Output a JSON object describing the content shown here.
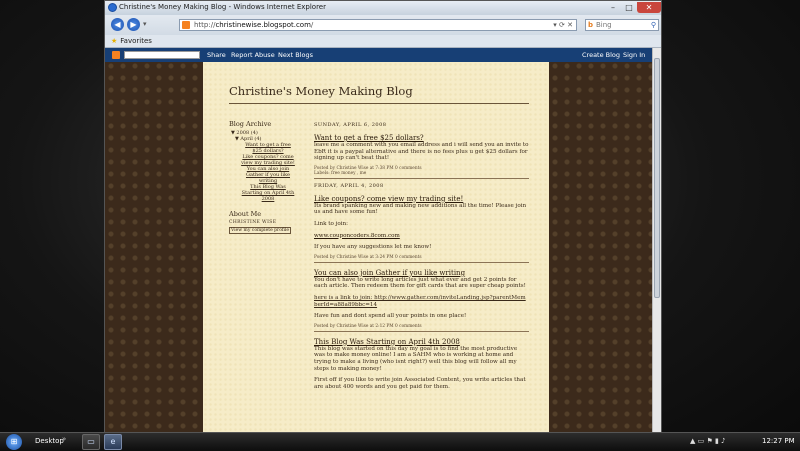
{
  "window": {
    "title": "Christine's Money Making Blog - Windows Internet Explorer",
    "minimize": "–",
    "maximize": "□",
    "close": "✕"
  },
  "nav": {
    "back_icon": "back-arrow-icon",
    "forward_icon": "forward-arrow-icon",
    "address_prefix": "http://",
    "address_host": "christinewise.blogspot.com",
    "address_suffix": "/",
    "search_engine": "Bing",
    "search_placeholder": ""
  },
  "favorites": {
    "label": "Favorites"
  },
  "blogger_bar": {
    "share": "Share",
    "report": "Report Abuse",
    "next": "Next Blogs",
    "create": "Create Blog",
    "signin": "Sign In"
  },
  "blog": {
    "title": "Christine's Money Making Blog"
  },
  "sidebar": {
    "archive_heading": "Blog Archive",
    "year": "▼ 2008 (4)",
    "month": "▼ April (4)",
    "links": [
      "Want to get a free $25 dollars?",
      "Like coupons? come view my trading site!",
      "You can also join Gather if you like writing",
      "This Blog Was Starting on April 4th 2008"
    ],
    "about_heading": "About Me",
    "author": "CHRISTINE WISE",
    "profile_link": "View my complete profile"
  },
  "posts": [
    {
      "date": "SUNDAY, APRIL 6, 2008",
      "title": "Want to get a free $25 dollars?",
      "body": [
        "leave me a comment with you email address and i will send you an invite to EbR it is a paypal alternative and there is no fees plus u get $25 dollars for signing up can't beat that!"
      ],
      "footer": "Posted by Christine Wise at 7:38 PM   0 comments",
      "labels": "Labels: free money , me"
    },
    {
      "date": "FRIDAY, APRIL 4, 2008",
      "title": "Like coupons? come view my trading site!",
      "body": [
        "Its brand spanking new and making new additions all the time! Please join us and have some fun!",
        "Link to join:",
        "www.couponcoders.8com.com",
        "If you have any suggestions let me know!"
      ],
      "footer": "Posted by Christine Wise at 3:24 PM   0 comments"
    },
    {
      "date": "",
      "title": "You can also join Gather if you like writing",
      "body": [
        "You don't have to write long articles just what ever and get 2 points for each article. Then redeem them for gift cards that are super cheap points!",
        "here is a link to join: http://www.gather.com/inviteLanding.jsp?parentMemberId=a88a89bbc=14",
        "Have fun and dont spend all your points in one place!"
      ],
      "footer": "Posted by Christine Wise at 2:12 PM   0 comments"
    },
    {
      "date": "",
      "title": "This Blog Was Starting on April 4th 2008",
      "body": [
        "This blog was started on this day my goal is to find the most productive was to make money online! I am a SAHM who is working at home and trying to make a living (who isnt right?) well this blog will follow all my steps to making money!",
        "First off if you like to write join Associated Content, you write articles that are about 400 words and you get paid for them."
      ],
      "footer": ""
    }
  ],
  "taskbar": {
    "desktop": "Desktop",
    "chevrons": "»",
    "clock": "12:27 PM"
  }
}
